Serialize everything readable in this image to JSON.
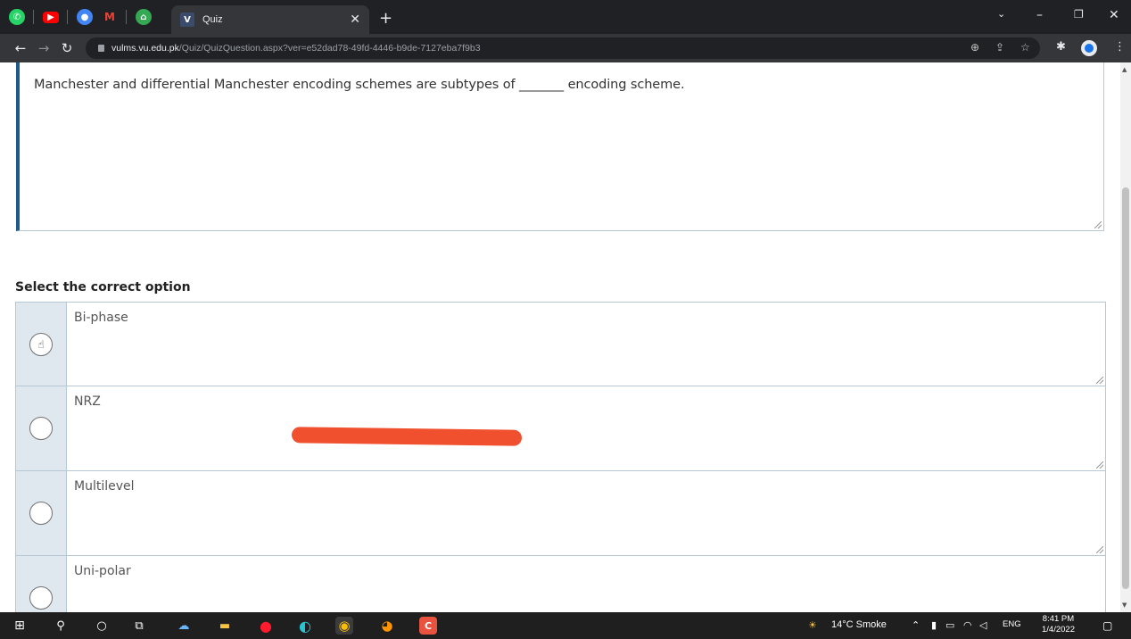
{
  "browser": {
    "tab_title": "Quiz",
    "url_host": "vulms.vu.edu.pk",
    "url_path": "/Quiz/QuizQuestion.aspx?ver=e52dad78-49fd-4446-b9de-7127eba7f9b3",
    "pinned_tabs": [
      "whatsapp-icon",
      "youtube-icon",
      "chrome-icon",
      "gmail-icon",
      "app-icon"
    ]
  },
  "quiz": {
    "question": "Manchester and differential Manchester encoding schemes are subtypes of _______ encoding scheme.",
    "select_label": "Select the correct option",
    "options": [
      {
        "text": "Bi-phase"
      },
      {
        "text": "NRZ"
      },
      {
        "text": "Multilevel"
      },
      {
        "text": "Uni-polar"
      }
    ]
  },
  "taskbar": {
    "weather": "14°C  Smoke",
    "language": "ENG",
    "time": "8:41 PM",
    "date": "1/4/2022"
  },
  "colors": {
    "accent_border": "#1e5a8a",
    "annotation_stroke": "#f0502e"
  }
}
